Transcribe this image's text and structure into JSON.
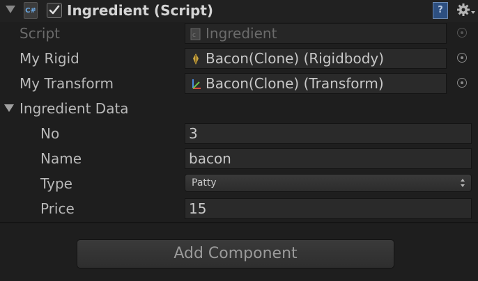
{
  "component": {
    "title": "Ingredient (Script)",
    "enabled": true,
    "icon": "csharp-script-icon",
    "icon_text": "C#",
    "help_icon_text": "?"
  },
  "properties": {
    "script": {
      "label": "Script",
      "value": "Ingredient"
    },
    "my_rigid": {
      "label": "My Rigid",
      "value": "Bacon(Clone) (Rigidbody)"
    },
    "my_transform": {
      "label": "My Transform",
      "value": "Bacon(Clone) (Transform)"
    }
  },
  "ingredient_data": {
    "label": "Ingredient Data",
    "no": {
      "label": "No",
      "value": "3"
    },
    "name": {
      "label": "Name",
      "value": "bacon"
    },
    "type": {
      "label": "Type",
      "value": "Patty"
    },
    "price": {
      "label": "Price",
      "value": "15"
    }
  },
  "add_component_label": "Add Component",
  "colors": {
    "background": "#1e1e1e",
    "field": "#2a2a2a",
    "help_icon": "#2d4f80"
  }
}
